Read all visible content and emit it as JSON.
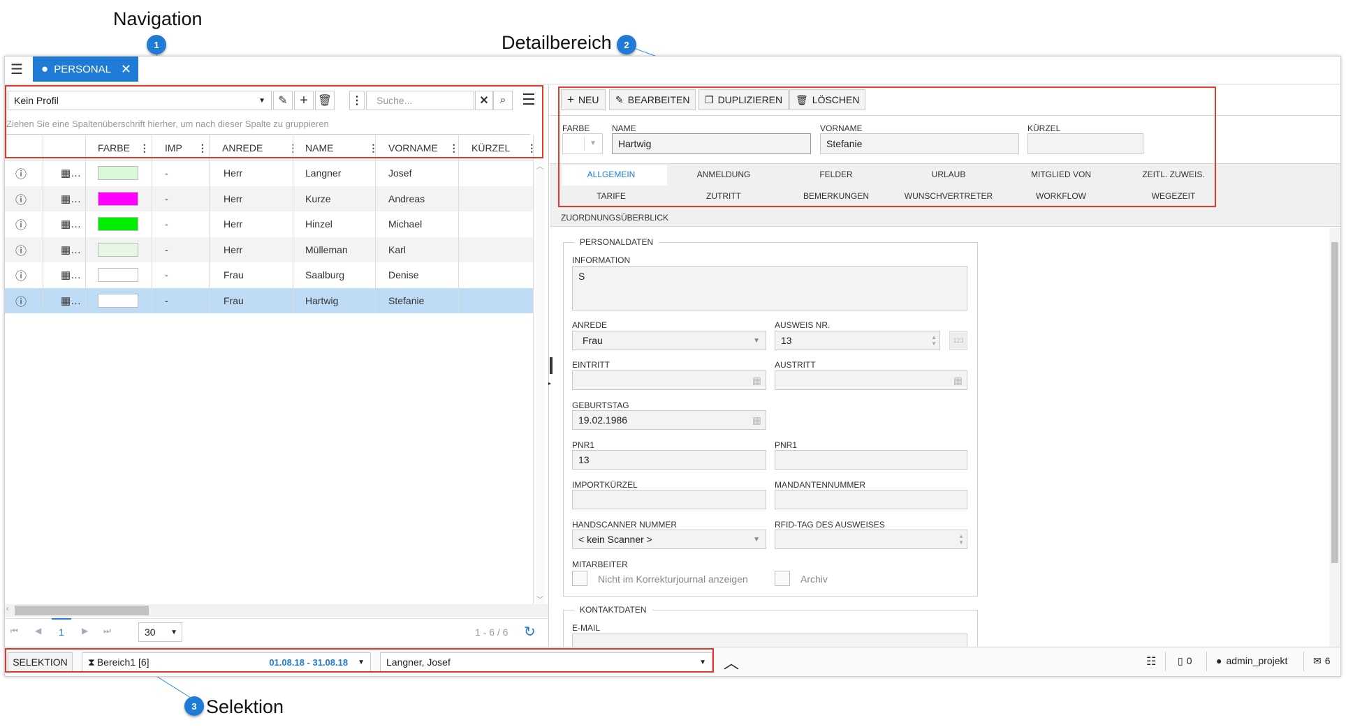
{
  "callouts": [
    {
      "label": "Navigation",
      "number": "1"
    },
    {
      "label": "Detailbereich",
      "number": "2"
    },
    {
      "label": "Selektion",
      "number": "3"
    }
  ],
  "app": {
    "tab_label": "PERSONAL",
    "tab_icon": "user-circle-icon"
  },
  "nav": {
    "profile_value": "Kein Profil",
    "search_placeholder": "Suche...",
    "group_hint": "Ziehen Sie eine Spaltenüberschrift hierher, um nach dieser Spalte zu gruppieren",
    "columns": [
      "FARBE",
      "IMP",
      "ANREDE",
      "NAME",
      "VORNAME",
      "KÜRZEL"
    ],
    "rows": [
      {
        "color": "#d9f7d9",
        "imp": "-",
        "anrede": "Herr",
        "name": "Langner",
        "vorname": "Josef",
        "kuerzel": ""
      },
      {
        "color": "#ff00ff",
        "imp": "-",
        "anrede": "Herr",
        "name": "Kurze",
        "vorname": "Andreas",
        "kuerzel": ""
      },
      {
        "color": "#00ee00",
        "imp": "-",
        "anrede": "Herr",
        "name": "Hinzel",
        "vorname": "Michael",
        "kuerzel": ""
      },
      {
        "color": "#e6f7e6",
        "imp": "-",
        "anrede": "Herr",
        "name": "Mülleman",
        "vorname": "Karl",
        "kuerzel": ""
      },
      {
        "color": "#ffffff",
        "imp": "-",
        "anrede": "Frau",
        "name": "Saalburg",
        "vorname": "Denise",
        "kuerzel": ""
      },
      {
        "color": "#ffffff",
        "imp": "-",
        "anrede": "Frau",
        "name": "Hartwig",
        "vorname": "Stefanie",
        "kuerzel": ""
      }
    ],
    "selected_row_index": 5,
    "pager": {
      "page": "1",
      "page_size": "30",
      "range": "1 - 6 / 6"
    }
  },
  "detail": {
    "toolbar": {
      "new": "NEU",
      "edit": "BEARBEITEN",
      "duplicate": "DUPLIZIEREN",
      "delete": "LÖSCHEN"
    },
    "header": {
      "farbe_label": "FARBE",
      "name_label": "NAME",
      "name_value": "Hartwig",
      "vorname_label": "VORNAME",
      "vorname_value": "Stefanie",
      "kuerzel_label": "KÜRZEL",
      "kuerzel_value": ""
    },
    "tabs_row1": [
      "ALLGEMEIN",
      "ANMELDUNG",
      "FELDER",
      "URLAUB",
      "MITGLIED VON",
      "ZEITL. ZUWEIS."
    ],
    "tabs_row2": [
      "TARIFE",
      "ZUTRITT",
      "BEMERKUNGEN",
      "WUNSCHVERTRETER",
      "WORKFLOW",
      "WEGEZEIT"
    ],
    "tab_row3": "ZUORDNUNGSÜBERBLICK",
    "active_tab": "ALLGEMEIN",
    "personaldaten": {
      "legend": "PERSONALDATEN",
      "information_label": "INFORMATION",
      "information_value": "S",
      "anrede_label": "ANREDE",
      "anrede_value": "Frau",
      "ausweis_label": "AUSWEIS NR.",
      "ausweis_value": "13",
      "ausweis_badge": "123",
      "eintritt_label": "EINTRITT",
      "eintritt_value": "",
      "austritt_label": "AUSTRITT",
      "austritt_value": "",
      "geburtstag_label": "GEBURTSTAG",
      "geburtstag_value": "19.02.1986",
      "pnr1_label": "PNR1",
      "pnr1_value": "13",
      "pnr1b_label": "PNR1",
      "pnr1b_value": "",
      "import_label": "IMPORTKÜRZEL",
      "import_value": "",
      "mandant_label": "MANDANTENNUMMER",
      "mandant_value": "",
      "scanner_label": "HANDSCANNER NUMMER",
      "scanner_value": "< kein Scanner >",
      "rfid_label": "RFID-TAG DES AUSWEISES",
      "rfid_value": "",
      "mitarbeiter_label": "MITARBEITER",
      "korrektur_label": "Nicht im Korrekturjournal anzeigen",
      "archiv_label": "Archiv"
    },
    "kontaktdaten": {
      "legend": "KONTAKTDATEN",
      "email_label": "E-MAIL"
    }
  },
  "statusbar": {
    "selektion_button": "SELEKTION",
    "bereich_value": "Bereich1 [6]",
    "date_range": "01.08.18 - 31.08.18",
    "person_value": "Langner, Josef",
    "pdf_count": "0",
    "user": "admin_projekt",
    "mail_count": "6"
  },
  "colors": {
    "accent": "#1e7bd6",
    "callout_red": "#e03a2a",
    "selected_row": "#bfdcf7",
    "alt_row": "#f3f3f3"
  }
}
